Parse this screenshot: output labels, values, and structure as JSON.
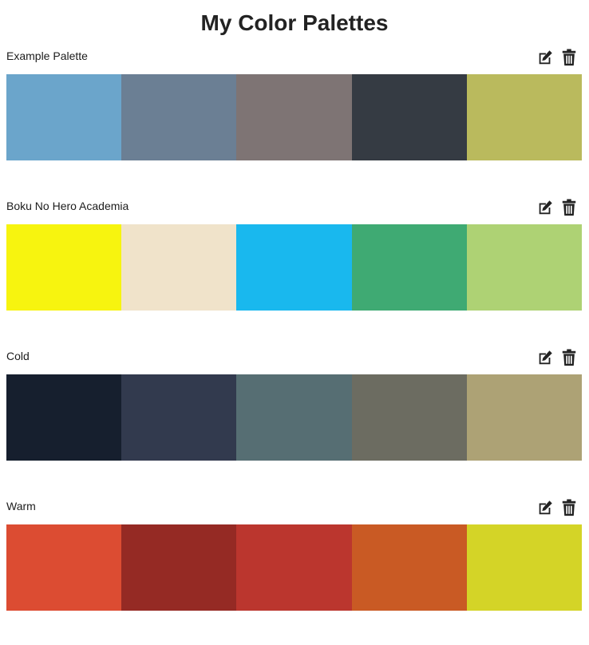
{
  "page": {
    "title": "My Color Palettes"
  },
  "icons": {
    "edit": "edit-icon",
    "delete": "trash-icon"
  },
  "palettes": [
    {
      "name": "Example Palette",
      "colors": [
        "#6BA5CB",
        "#6B7F94",
        "#7E7474",
        "#353B43",
        "#BABA5D"
      ]
    },
    {
      "name": "Boku No Hero Academia",
      "colors": [
        "#F7F40F",
        "#F0E3CA",
        "#19B8EE",
        "#3FAA73",
        "#AED274"
      ]
    },
    {
      "name": "Cold",
      "colors": [
        "#161F2E",
        "#323A4E",
        "#566E73",
        "#6C6C61",
        "#ADA275"
      ]
    },
    {
      "name": "Warm",
      "colors": [
        "#DC4C32",
        "#952A24",
        "#BB362E",
        "#C95A24",
        "#D4D427"
      ]
    }
  ]
}
